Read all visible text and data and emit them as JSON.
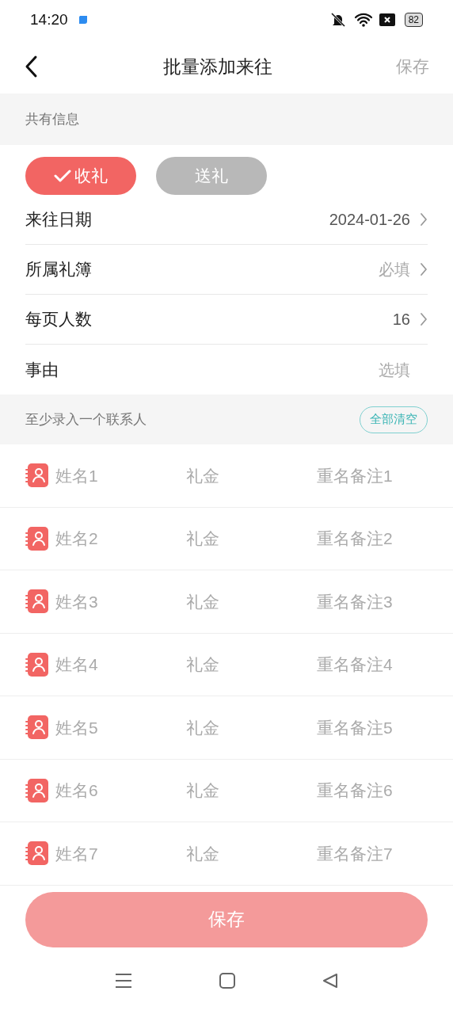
{
  "status_bar": {
    "time": "14:20",
    "battery": "82"
  },
  "nav": {
    "title": "批量添加来往",
    "action": "保存"
  },
  "shared_section": {
    "header": "共有信息"
  },
  "direction_options": [
    {
      "label": "收礼",
      "selected": true
    },
    {
      "label": "送礼",
      "selected": false
    }
  ],
  "fields": [
    {
      "label": "来往日期",
      "value": "2024-01-26",
      "chevron": true
    },
    {
      "label": "所属礼簿",
      "placeholder": "必填",
      "chevron": true
    },
    {
      "label": "每页人数",
      "value": "16",
      "chevron": true
    },
    {
      "label": "事由",
      "placeholder": "选填",
      "chevron": false
    }
  ],
  "contacts_section": {
    "header": "至少录入一个联系人",
    "clear_button": "全部清空"
  },
  "contacts": [
    {
      "name_placeholder": "姓名1",
      "amount_placeholder": "礼金",
      "remark_placeholder": "重名备注1"
    },
    {
      "name_placeholder": "姓名2",
      "amount_placeholder": "礼金",
      "remark_placeholder": "重名备注2"
    },
    {
      "name_placeholder": "姓名3",
      "amount_placeholder": "礼金",
      "remark_placeholder": "重名备注3"
    },
    {
      "name_placeholder": "姓名4",
      "amount_placeholder": "礼金",
      "remark_placeholder": "重名备注4"
    },
    {
      "name_placeholder": "姓名5",
      "amount_placeholder": "礼金",
      "remark_placeholder": "重名备注5"
    },
    {
      "name_placeholder": "姓名6",
      "amount_placeholder": "礼金",
      "remark_placeholder": "重名备注6"
    },
    {
      "name_placeholder": "姓名7",
      "amount_placeholder": "礼金",
      "remark_placeholder": "重名备注7"
    }
  ],
  "save_button": {
    "label": "保存",
    "disabled": true
  }
}
